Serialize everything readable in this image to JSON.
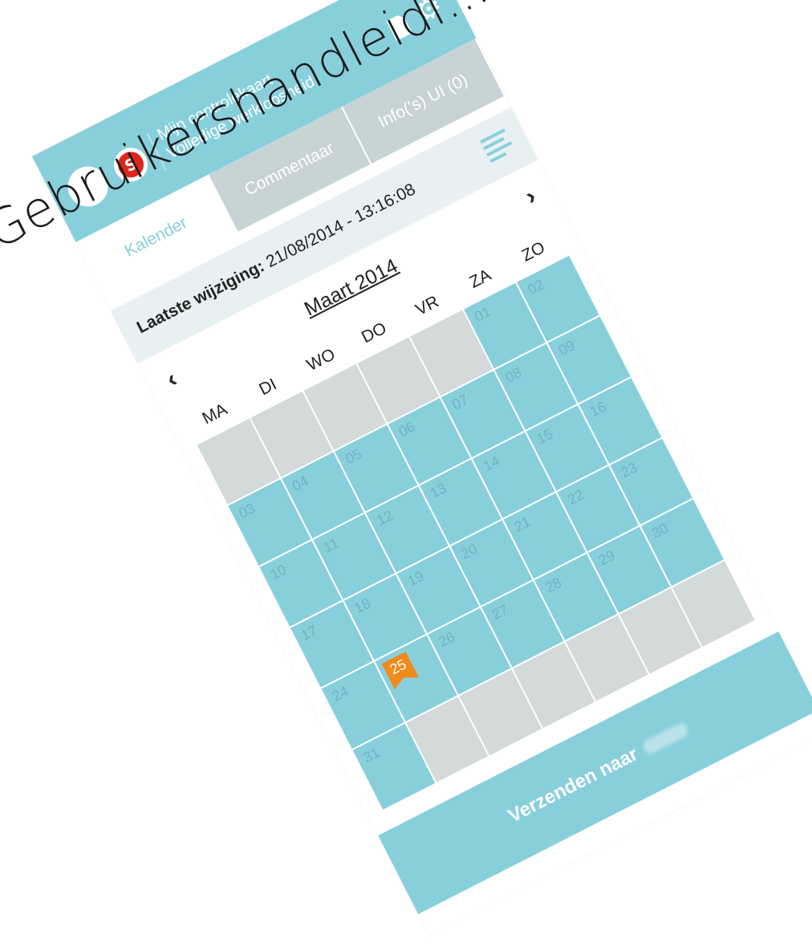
{
  "overlay": {
    "handwriting": "Gebruikershandleidi..."
  },
  "header": {
    "title_line1": "Mijn controlekaart",
    "title_line2": "Volledige werkloosheid",
    "logo_letter": "S"
  },
  "tabs": [
    {
      "label": "Kalender",
      "active": true
    },
    {
      "label": "Commentaar",
      "active": false
    },
    {
      "label": "Info('s) UI (0)",
      "active": false
    }
  ],
  "last_change": {
    "label": "Laatste wijziging:",
    "value": "21/08/2014 - 13:16:08"
  },
  "month_nav": {
    "prev": "‹",
    "next": "›",
    "month": "Maart 2014"
  },
  "weekdays": [
    "MA",
    "DI",
    "WO",
    "DO",
    "VR",
    "ZA",
    "ZO"
  ],
  "calendar": {
    "days": [
      "",
      "",
      "",
      "",
      "",
      "01",
      "02",
      "03",
      "04",
      "05",
      "06",
      "07",
      "08",
      "09",
      "10",
      "11",
      "12",
      "13",
      "14",
      "15",
      "16",
      "17",
      "18",
      "19",
      "20",
      "21",
      "22",
      "23",
      "24",
      "25",
      "26",
      "27",
      "28",
      "29",
      "30",
      "31",
      "",
      "",
      "",
      "",
      "",
      ""
    ],
    "flagged_day": "25"
  },
  "send_button": {
    "label": "Verzenden naar"
  },
  "colors": {
    "accent": "#88cfdc",
    "empty_cell": "#d4d9da",
    "flag": "#f08a1c",
    "tab_inactive": "#c8d3d6"
  }
}
